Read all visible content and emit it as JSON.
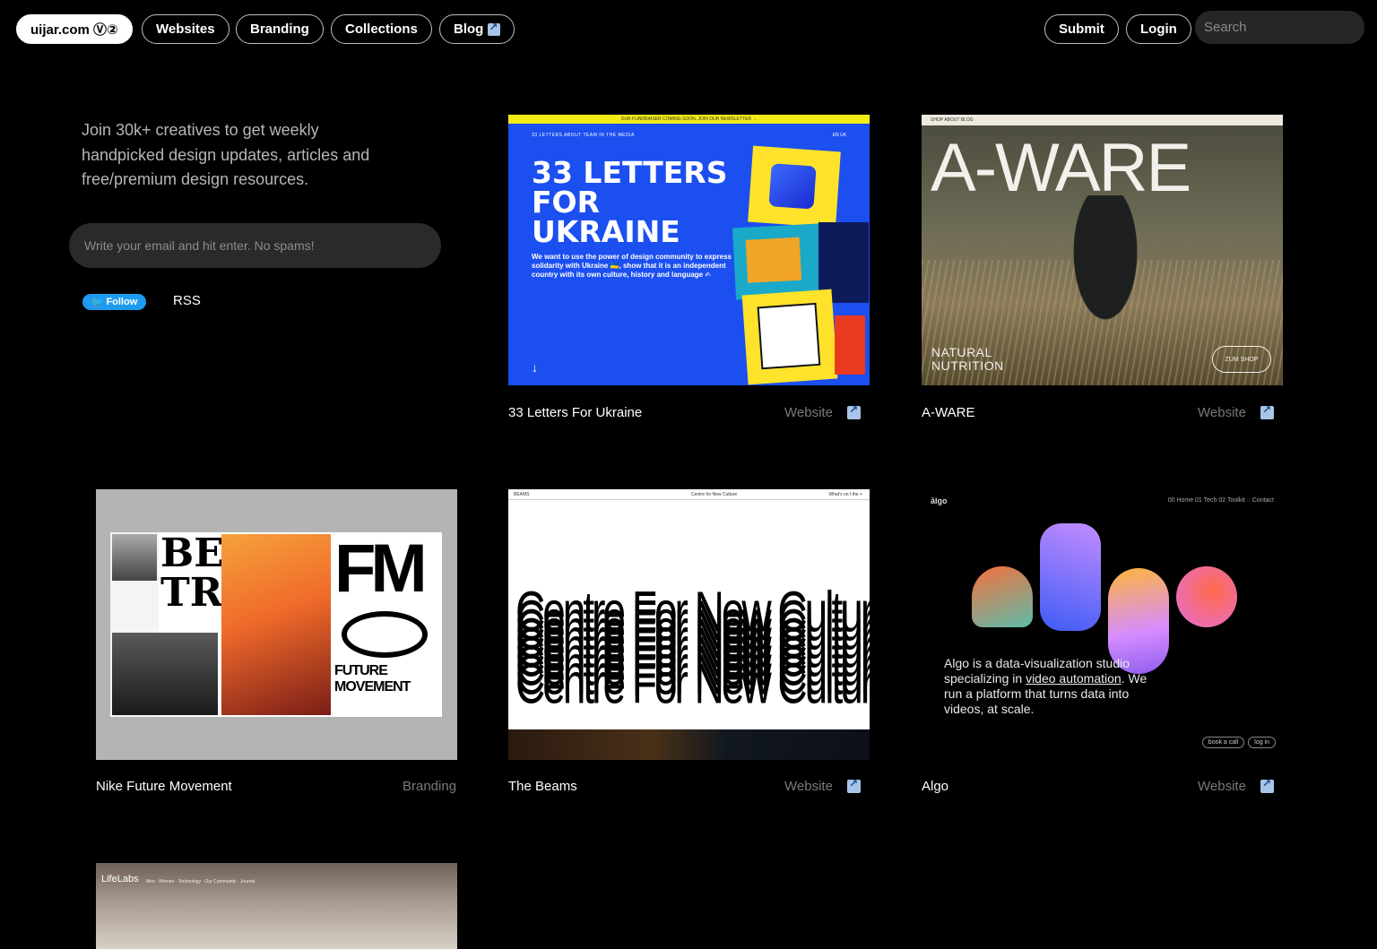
{
  "nav": {
    "brand": "uijar.com Ⓥ②",
    "items": [
      "Websites",
      "Branding",
      "Collections",
      "Blog"
    ],
    "submit": "Submit",
    "login": "Login",
    "search_placeholder": "Search"
  },
  "intro": {
    "text": "Join 30k+ creatives to get weekly handpicked design updates, articles and free/premium design resources.",
    "email_placeholder": "Write your email and hit enter. No spams!",
    "follow": "Follow",
    "rss": "RSS"
  },
  "cards": [
    {
      "title": "33 Letters For Ukraine",
      "type": "Website",
      "thumb": {
        "topbar": "OUR FUNDRAISER COMING SOON. JOIN OUR NEWSLETTER →",
        "nav": "33 LETTERS   ABOUT   TEAM   IN THE MEDIA",
        "lang": "EN   UK",
        "heading": "33 LETTERS FOR UKRAINE",
        "desc": "We want to use the power of design community to express solidarity with Ukraine 🇺🇦, show that it is an independent country with its own culture, history and language ✍",
        "arrow": "↓"
      }
    },
    {
      "title": "A-WARE",
      "type": "Website",
      "thumb": {
        "nav": "SHOP   ABOUT   BLOG",
        "big": "A-WARE",
        "tag": "NATURAL NUTRITION",
        "shop": "ZUM SHOP"
      }
    },
    {
      "title": "Nike Future Movement",
      "type": "Branding",
      "thumb": {
        "betrue": "BE TRUE",
        "fm": "FM",
        "future": "FUTURE MOVEMENT"
      }
    },
    {
      "title": "The Beams",
      "type": "Website",
      "thumb": {
        "bar_left": "BEAMS",
        "bar_center": "Centre for New Culture",
        "bar_right": "What's on   I the   +",
        "line": "Centre For New Culture"
      }
    },
    {
      "title": "Algo",
      "type": "Website",
      "thumb": {
        "logo": "ālgo",
        "nav": "00 Home   01 Tech   02 Toolkit   ◌ Contact",
        "text_a": "Algo is a data-visualization studio specializing in ",
        "text_link": "video automation",
        "text_b": ". We run a platform that turns data into videos, at scale.",
        "btn1": "book a call",
        "btn2": "log in"
      }
    },
    {
      "thumb": {
        "logo": "LifeLabs",
        "nav": "Men  ·  Women  ·  Technology  ·  Our Community  ·  Journal"
      }
    }
  ]
}
